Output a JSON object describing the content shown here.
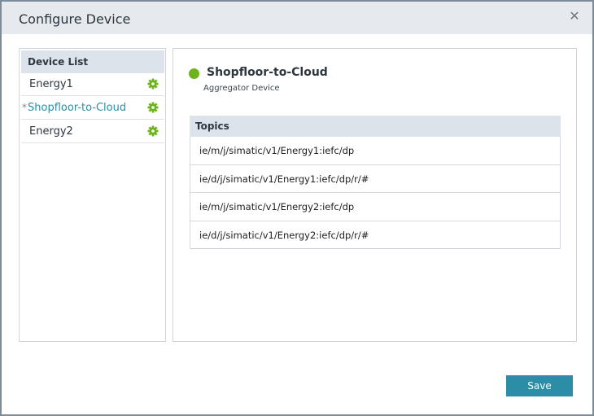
{
  "dialog": {
    "title": "Configure Device",
    "close_icon": "close-icon"
  },
  "device_list": {
    "header": "Device List",
    "items": [
      {
        "label": "Energy1",
        "selected": false,
        "icon": "gear-icon"
      },
      {
        "label": "Shopfloor-to-Cloud",
        "selected": true,
        "marker": "*",
        "icon": "gear-icon"
      },
      {
        "label": "Energy2",
        "selected": false,
        "icon": "gear-icon"
      }
    ]
  },
  "detail": {
    "status_color": "#6cb31c",
    "name": "Shopfloor-to-Cloud",
    "type": "Aggregator Device",
    "topics_header": "Topics",
    "topics": [
      "ie/m/j/simatic/v1/Energy1:iefc/dp",
      "ie/d/j/simatic/v1/Energy1:iefc/dp/r/#",
      "ie/m/j/simatic/v1/Energy2:iefc/dp",
      "ie/d/j/simatic/v1/Energy2:iefc/dp/r/#"
    ]
  },
  "footer": {
    "save_label": "Save"
  },
  "colors": {
    "accent": "#2b8ea6",
    "gear": "#6cb31c",
    "header_bg": "#e6e9ee"
  }
}
